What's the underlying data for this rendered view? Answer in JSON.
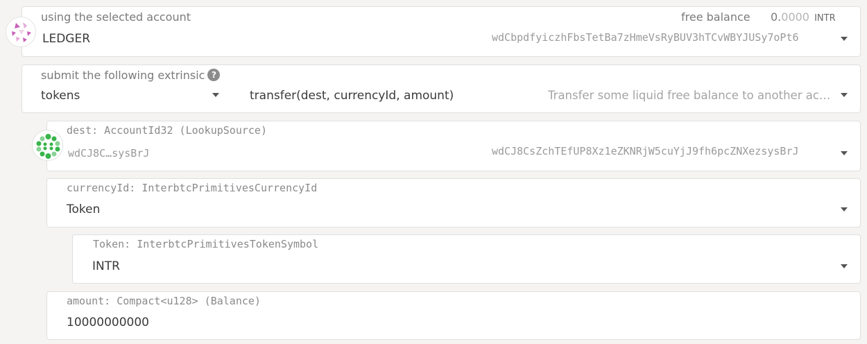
{
  "account": {
    "label": "using the selected account",
    "name": "LEDGER",
    "free_balance_label": "free balance",
    "balance_int": "0.",
    "balance_frac": "0000",
    "balance_unit": "INTR",
    "address": "wdCbpdfyiczhFbsTetBa7zHmeVsRyBUV3hTCvWBYJUSy7oPt6"
  },
  "extrinsic": {
    "label": "submit the following extrinsic",
    "help_glyph": "?",
    "section": "tokens",
    "method": "transfer(dest, currencyId, amount)",
    "description": "Transfer some liquid free balance to another ac…"
  },
  "params": {
    "dest": {
      "label": "dest: AccountId32 (LookupSource)",
      "short": "wdCJ8C…sysBrJ",
      "address": "wdCJ8CsZchTEfUP8Xz1eZKNRjW5cuYjJ9fh6pcZNXezsysBrJ"
    },
    "currency": {
      "label": "currencyId: InterbtcPrimitivesCurrencyId",
      "value": "Token"
    },
    "token": {
      "label": "Token: InterbtcPrimitivesTokenSymbol",
      "value": "INTR"
    },
    "amount": {
      "label": "amount: Compact<u128> (Balance)",
      "value": "10000000000"
    }
  },
  "colors": {
    "identicon_pink": "#c861b8",
    "identicon_green": "#37b44a"
  }
}
